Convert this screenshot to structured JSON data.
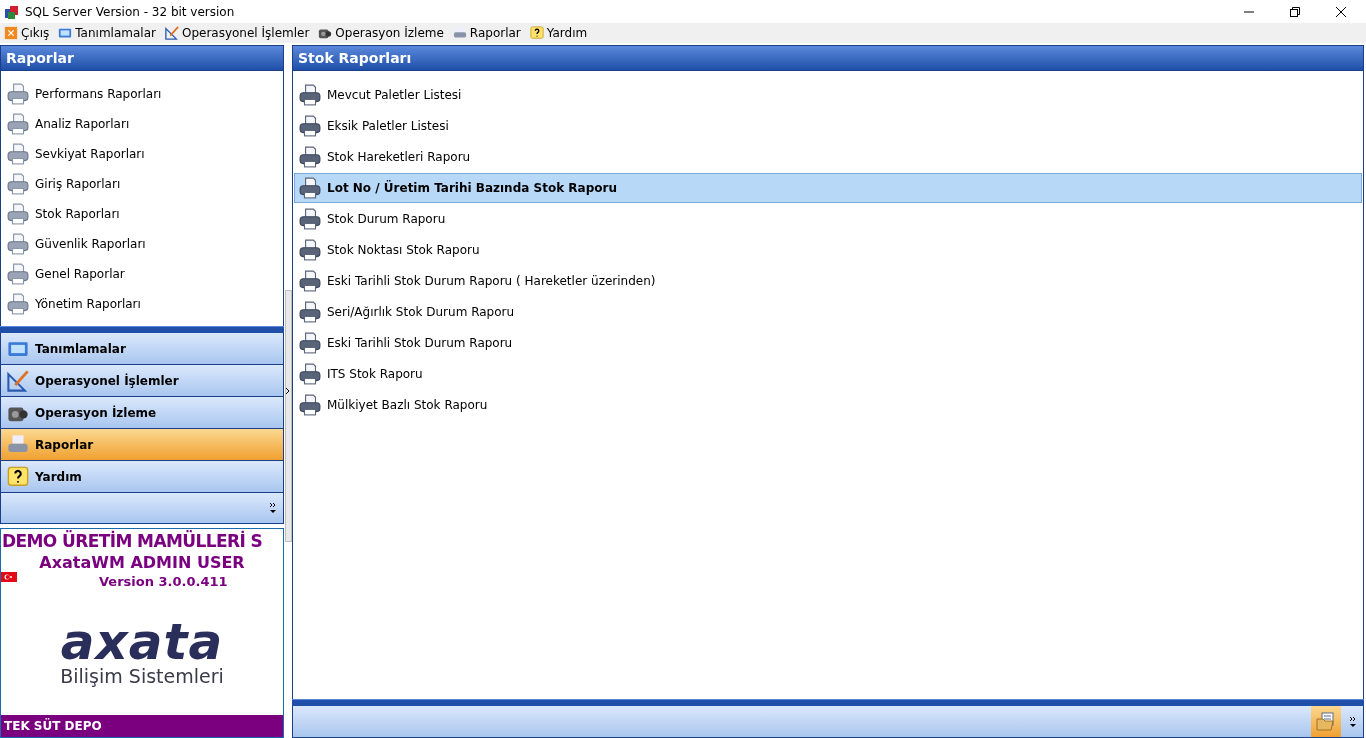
{
  "window": {
    "title": "SQL Server Version - 32 bit version"
  },
  "menu": [
    {
      "label": "Çıkış",
      "kind": "exit"
    },
    {
      "label": "Tanımlamalar",
      "kind": "definitions"
    },
    {
      "label": "Operasyonel İşlemler",
      "kind": "operations"
    },
    {
      "label": "Operasyon İzleme",
      "kind": "monitoring"
    },
    {
      "label": "Raporlar",
      "kind": "reports"
    },
    {
      "label": "Yardım",
      "kind": "help"
    }
  ],
  "sidebar": {
    "title": "Raporlar",
    "items": [
      {
        "label": "Performans Raporları"
      },
      {
        "label": "Analiz Raporları"
      },
      {
        "label": "Sevkiyat Raporları"
      },
      {
        "label": "Giriş Raporları"
      },
      {
        "label": "Stok Raporları"
      },
      {
        "label": "Güvenlik Raporları"
      },
      {
        "label": "Genel Raporlar"
      },
      {
        "label": "Yönetim Raporları"
      }
    ],
    "nav": [
      {
        "label": "Tanımlamalar",
        "kind": "definitions",
        "selected": false
      },
      {
        "label": "Operasyonel İşlemler",
        "kind": "operations",
        "selected": false
      },
      {
        "label": "Operasyon İzleme",
        "kind": "monitoring",
        "selected": false
      },
      {
        "label": "Raporlar",
        "kind": "reports",
        "selected": true
      },
      {
        "label": "Yardım",
        "kind": "help",
        "selected": false
      }
    ]
  },
  "info": {
    "company": "DEMO ÜRETİM MAMÜLLERİ S",
    "user": "AxataWM ADMIN USER",
    "version": "Version 3.0.0.411",
    "logo": "axata",
    "logo_sub": "Bilişim Sistemleri",
    "depot": "TEK SÜT DEPO"
  },
  "content": {
    "title": "Stok Raporları",
    "items": [
      {
        "label": "Mevcut Paletler Listesi",
        "selected": false
      },
      {
        "label": "Eksik Paletler Listesi",
        "selected": false
      },
      {
        "label": "Stok Hareketleri Raporu",
        "selected": false
      },
      {
        "label": "Lot No / Üretim Tarihi Bazında Stok Raporu",
        "selected": true
      },
      {
        "label": "Stok Durum Raporu",
        "selected": false
      },
      {
        "label": "Stok Noktası Stok Raporu",
        "selected": false
      },
      {
        "label": "Eski Tarihli Stok Durum Raporu ( Hareketler üzerinden)",
        "selected": false
      },
      {
        "label": "Seri/Ağırlık Stok Durum Raporu",
        "selected": false
      },
      {
        "label": "Eski Tarihli Stok Durum Raporu",
        "selected": false
      },
      {
        "label": "ITS Stok Raporu",
        "selected": false
      },
      {
        "label": "Mülkiyet Bazlı Stok Raporu",
        "selected": false
      }
    ]
  }
}
